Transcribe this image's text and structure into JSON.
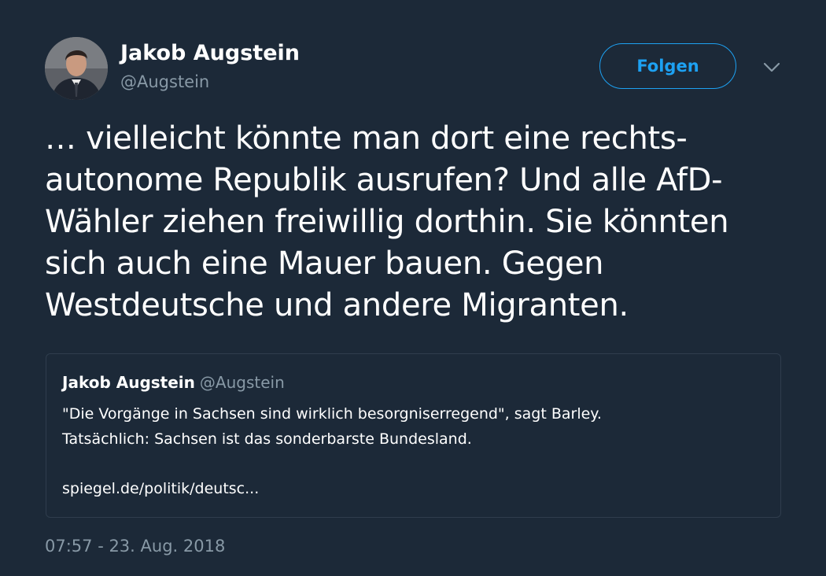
{
  "author": {
    "name": "Jakob Augstein",
    "handle": "@Augstein"
  },
  "follow_button": {
    "label": "Folgen"
  },
  "menu_caret": {
    "icon": "chevron-down-icon"
  },
  "tweet": {
    "lines": [
      "… vielleicht könnte man dort eine rechts-",
      "autonome Republik ausrufen? Und alle AfD-",
      "Wähler ziehen freiwillig dorthin. Sie könnten",
      "sich auch eine Mauer bauen. Gegen",
      "Westdeutsche und andere Migranten."
    ]
  },
  "quoted_tweet": {
    "name": "Jakob Augstein",
    "handle": "@Augstein",
    "lines": [
      "\"Die Vorgänge in Sachsen sind wirklich besorgniserregend\", sagt Barley.",
      "Tatsächlich: Sachsen ist das sonderbarste Bundesland."
    ],
    "link": "spiegel.de/politik/deutsc..."
  },
  "timestamp": "07:57 - 23. Aug. 2018",
  "colors": {
    "background": "#1c2938",
    "accent": "#1da1f2",
    "muted": "#8899a6"
  }
}
